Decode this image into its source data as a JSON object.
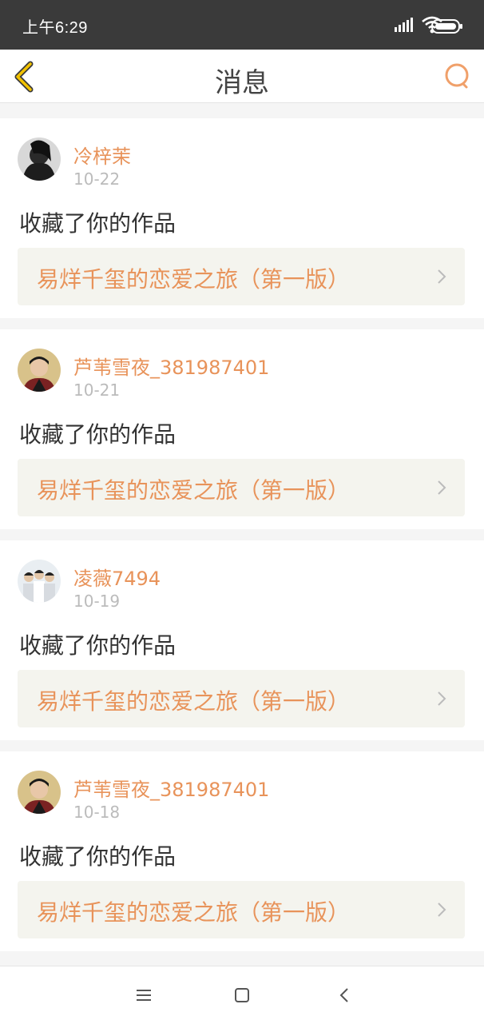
{
  "status_bar": {
    "time": "上午6:29",
    "icons": [
      "signal-icon",
      "wifi-icon",
      "battery-icon"
    ]
  },
  "header": {
    "title": "消息",
    "back_icon": "chevron-left-icon",
    "search_icon": "search-icon",
    "accent_color": "#e8935a",
    "back_icon_color": "#f2c200"
  },
  "messages": [
    {
      "user": "冷梓茉",
      "date": "10-22",
      "action": "收藏了你的作品",
      "work": "易烊千玺的恋爱之旅（第一版）"
    },
    {
      "user": "芦苇雪夜_381987401",
      "date": "10-21",
      "action": "收藏了你的作品",
      "work": "易烊千玺的恋爱之旅（第一版）"
    },
    {
      "user": "凌薇7494",
      "date": "10-19",
      "action": "收藏了你的作品",
      "work": "易烊千玺的恋爱之旅（第一版）"
    },
    {
      "user": "芦苇雪夜_381987401",
      "date": "10-18",
      "action": "收藏了你的作品",
      "work": "易烊千玺的恋爱之旅（第一版）"
    }
  ],
  "bottom_nav": {
    "icons": [
      "menu-icon",
      "home-icon",
      "back-icon"
    ]
  }
}
